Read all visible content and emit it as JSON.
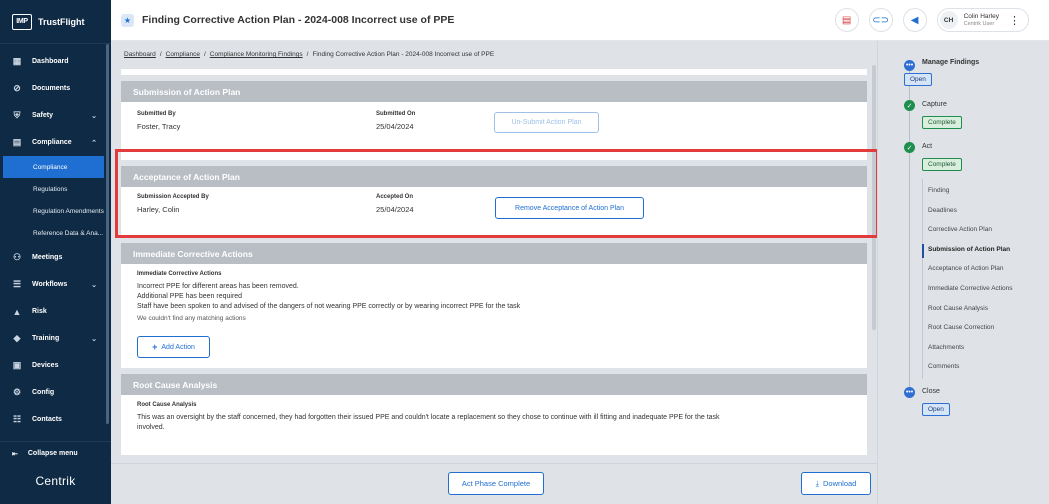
{
  "brand": {
    "logo": "IMP",
    "name": "TrustFlight",
    "footer": "Centrik"
  },
  "sidebar": {
    "items": [
      {
        "label": "Dashboard",
        "icon": "dashboard-icon"
      },
      {
        "label": "Documents",
        "icon": "paperclip-icon"
      },
      {
        "label": "Safety",
        "icon": "shield-icon"
      },
      {
        "label": "Compliance",
        "icon": "document-icon"
      },
      {
        "label": "Meetings",
        "icon": "meetings-icon"
      },
      {
        "label": "Workflows",
        "icon": "workflow-icon"
      },
      {
        "label": "Risk",
        "icon": "warning-icon"
      },
      {
        "label": "Training",
        "icon": "graduation-icon"
      },
      {
        "label": "Devices",
        "icon": "devices-icon"
      },
      {
        "label": "Config",
        "icon": "config-icon"
      },
      {
        "label": "Contacts",
        "icon": "contacts-icon"
      }
    ],
    "compliance_sub": [
      "Compliance",
      "Regulations",
      "Regulation Amendments",
      "Reference Data & Ana..."
    ],
    "collapse_label": "Collapse menu"
  },
  "header": {
    "title": "Finding Corrective Action Plan - 2024-008 Incorrect use of PPE",
    "user_initials": "CH",
    "user_name": "Colin Harley",
    "user_role": "Centrik User"
  },
  "breadcrumb": {
    "items": [
      "Dashboard",
      "Compliance",
      "Compliance Monitoring Findings"
    ],
    "current": "Finding Corrective Action Plan - 2024-008 Incorrect use of PPE"
  },
  "submission": {
    "title": "Submission of Action Plan",
    "by_label": "Submitted By",
    "by_value": "Foster, Tracy",
    "on_label": "Submitted On",
    "on_value": "25/04/2024",
    "button": "Un-Submit Action Plan"
  },
  "acceptance": {
    "title": "Acceptance of Action Plan",
    "by_label": "Submission Accepted By",
    "by_value": "Harley, Colin",
    "on_label": "Accepted On",
    "on_value": "25/04/2024",
    "button": "Remove Acceptance of Action Plan"
  },
  "immediate": {
    "title": "Immediate Corrective Actions",
    "label": "Immediate Corrective Actions",
    "lines": [
      "Incorrect PPE for different areas has been removed.",
      "Additional PPE has been required",
      "Staff have been spoken to and advised of the dangers of not wearing PPE correctly or by wearing incorrect PPE for the task"
    ],
    "empty": "We couldn't find any matching actions",
    "add_button": "Add Action"
  },
  "root_cause": {
    "title": "Root Cause Analysis",
    "label": "Root Cause Analysis",
    "line1": "This was an oversight by the staff concerned, they had forgotten their issued PPE and couldn't locate a replacement so they chose to continue with ill fitting and inadequate PPE for the task",
    "line2": "involved."
  },
  "footer": {
    "complete_button": "Act Phase Complete",
    "download_button": "Download"
  },
  "progress": {
    "manage_label": "Manage Findings",
    "manage_status": "Open",
    "capture_label": "Capture",
    "capture_status": "Complete",
    "act_label": "Act",
    "act_status": "Complete",
    "steps": [
      "Finding",
      "Deadlines",
      "Corrective Action Plan",
      "Submission of Action Plan",
      "Acceptance of Action Plan",
      "Immediate Corrective Actions",
      "Root Cause Analysis",
      "Root Cause Correction",
      "Attachments",
      "Comments"
    ],
    "close_label": "Close",
    "close_status": "Open"
  },
  "colors": {
    "sidebar": "#0f2a44",
    "accent": "#1e6fd1",
    "highlight": "#e23b3b",
    "complete": "#1e8e4f"
  }
}
